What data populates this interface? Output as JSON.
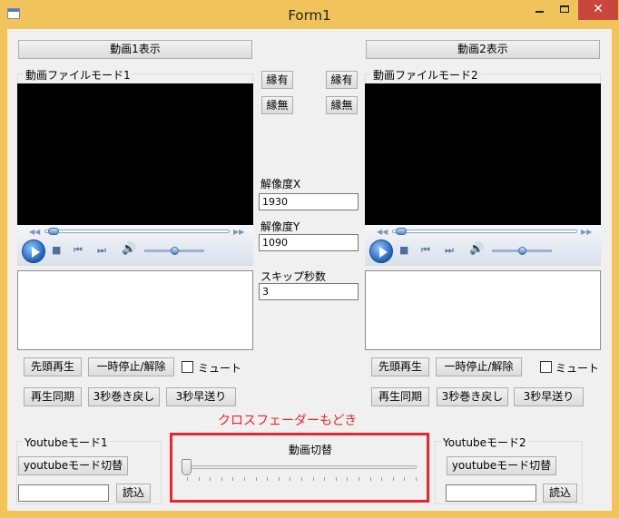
{
  "window": {
    "title": "Form1"
  },
  "left": {
    "show_button": "動画1表示",
    "group_title": "動画ファイルモード1",
    "restart_button": "先頭再生",
    "pause_button": "一時停止/解除",
    "mute_label": "ミュート",
    "sync_button": "再生同期",
    "rewind_button": "3秒巻き戻し",
    "forward_button": "3秒早送り",
    "border_on_button": "縁有",
    "border_off_button": "縁無",
    "youtube_group_title": "Youtubeモード1",
    "youtube_switch_button": "youtubeモード切替",
    "youtube_url_value": "",
    "load_button": "読込",
    "seek_fraction": 0.02,
    "volume_fraction": 0.5
  },
  "right": {
    "show_button": "動画2表示",
    "group_title": "動画ファイルモード2",
    "restart_button": "先頭再生",
    "pause_button": "一時停止/解除",
    "mute_label": "ミュート",
    "sync_button": "再生同期",
    "rewind_button": "3秒巻き戻し",
    "forward_button": "3秒早送り",
    "border_on_button": "縁有",
    "border_off_button": "縁無",
    "youtube_group_title": "Youtubeモード2",
    "youtube_switch_button": "youtubeモード切替",
    "youtube_url_value": "",
    "load_button": "読込",
    "seek_fraction": 0.02,
    "volume_fraction": 0.5
  },
  "center": {
    "resolution_x_label": "解像度X",
    "resolution_x_value": "1930",
    "resolution_y_label": "解像度Y",
    "resolution_y_value": "1090",
    "skip_label": "スキップ秒数",
    "skip_value": "3",
    "switch_label": "動画切替",
    "crossfade_fraction": 0.0
  },
  "annotation": {
    "text": "クロスフェーダーもどき",
    "color": "#e8262b"
  }
}
